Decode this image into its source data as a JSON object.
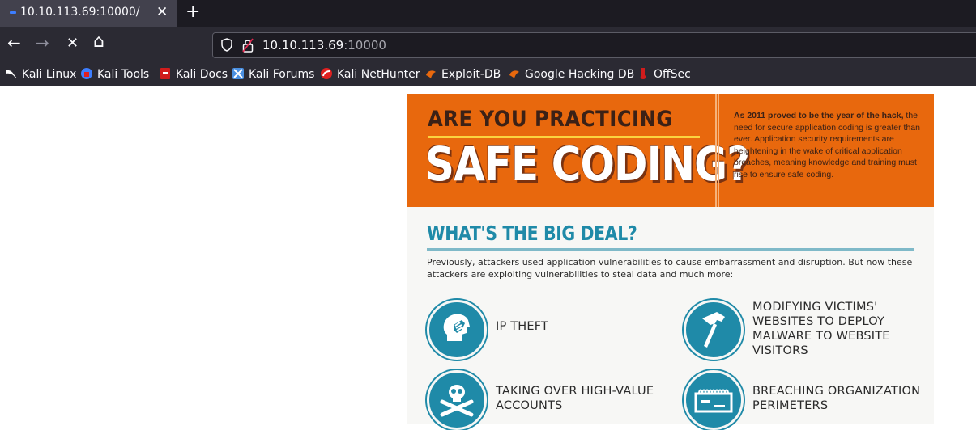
{
  "browser": {
    "tab_title": "10.10.113.69:10000/",
    "tab_close": "✕",
    "new_tab": "+",
    "url_host": "10.10.113.69",
    "url_port": ":10000",
    "back": "←",
    "forward": "→",
    "stop": "✕",
    "home": "⌂"
  },
  "bookmarks": [
    {
      "label": "Kali Linux",
      "icon": "kali-dragon-icon",
      "color": "#ffffff"
    },
    {
      "label": "Kali Tools",
      "icon": "kali-tools-icon",
      "color": "#3d7eff"
    },
    {
      "label": "Kali Docs",
      "icon": "kali-docs-icon",
      "color": "#d01c1c"
    },
    {
      "label": "Kali Forums",
      "icon": "kali-forums-icon",
      "color": "#4a90e2"
    },
    {
      "label": "Kali NetHunter",
      "icon": "kali-nethunter-icon",
      "color": "#e02020"
    },
    {
      "label": "Exploit-DB",
      "icon": "exploit-db-icon",
      "color": "#e8680d"
    },
    {
      "label": "Google Hacking DB",
      "icon": "ghdb-icon",
      "color": "#e8680d"
    },
    {
      "label": "OffSec",
      "icon": "offsec-icon",
      "color": "#d01c1c"
    }
  ],
  "infographic": {
    "headline_top": "ARE YOU PRACTICING",
    "headline_main": "SAFE CODING?",
    "blurb_bold": "As 2011 proved to be the year of the hack,",
    "blurb_rest": "the need for secure application coding is greater than ever. Application security requirements are heightening in the wake of critical application breaches, meaning knowledge and training must rise to ensure safe coding.",
    "section_title": "WHAT'S THE BIG DEAL?",
    "intro": "Previously, attackers used application vulnerabilities to cause embarrassment and disruption. But now these attackers are exploiting vulnerabilities to steal data and much more:",
    "items": [
      {
        "label": "IP THEFT",
        "icon": "head-hand-icon"
      },
      {
        "label": "MODIFYING VICTIMS' WEBSITES TO DEPLOY MALWARE TO WEBSITE VISITORS",
        "icon": "hammer-icon"
      },
      {
        "label": "TAKING OVER HIGH-VALUE ACCOUNTS",
        "icon": "skull-crossbones-icon"
      },
      {
        "label": "BREACHING ORGANIZATION PERIMETERS",
        "icon": "firewall-icon"
      }
    ],
    "colors": {
      "orange": "#e8680d",
      "teal": "#1f8aa8",
      "brown": "#3b2116"
    }
  }
}
